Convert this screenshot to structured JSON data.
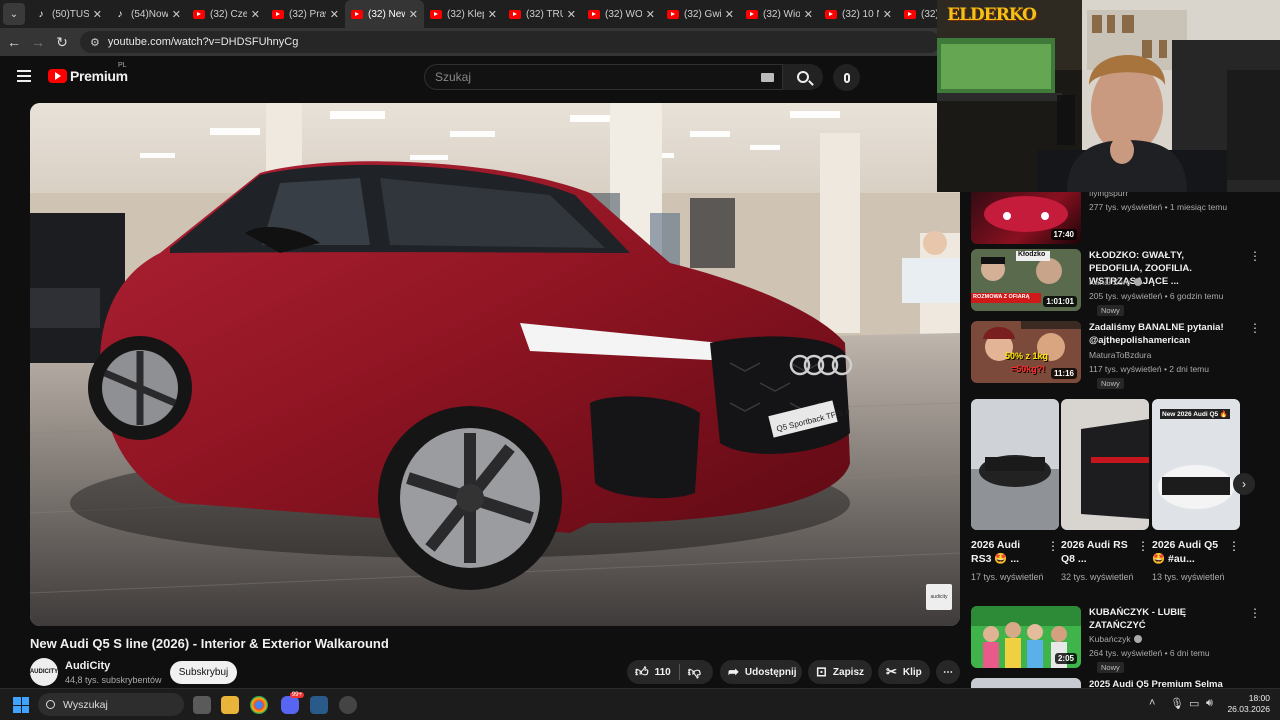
{
  "browser": {
    "tabs": [
      {
        "label": "(50)TUS2",
        "favicon": "tiktok-icon",
        "active": false
      },
      {
        "label": "(54)Now",
        "favicon": "tiktok-icon",
        "active": false
      },
      {
        "label": "(32) Czem",
        "favicon": "youtube-icon",
        "active": false
      },
      {
        "label": "(32) Prawd",
        "favicon": "youtube-icon",
        "active": false
      },
      {
        "label": "(32) New",
        "favicon": "youtube-icon",
        "active": true
      },
      {
        "label": "(32) Klep",
        "favicon": "youtube-icon",
        "active": false
      },
      {
        "label": "(32) TRU",
        "favicon": "youtube-icon",
        "active": false
      },
      {
        "label": "(32) WOJ",
        "favicon": "youtube-icon",
        "active": false
      },
      {
        "label": "(32) Gwia",
        "favicon": "youtube-icon",
        "active": false
      },
      {
        "label": "(32) Wio",
        "favicon": "youtube-icon",
        "active": false
      },
      {
        "label": "(32) 10 N",
        "favicon": "youtube-icon",
        "active": false
      },
      {
        "label": "(32) I",
        "favicon": "youtube-icon",
        "active": false
      }
    ],
    "url": "youtube.com/watch?v=DHDSFUhnyCg"
  },
  "youtube": {
    "logo_text": "Premium",
    "logo_region": "PL",
    "search_placeholder": "Szukaj"
  },
  "video": {
    "title": "New Audi Q5 S line (2026) - Interior & Exterior Walkaround",
    "channel": "AudiCity",
    "channel_avatar_text": "AUDICITY",
    "subscribers": "44,8 tys. subskrybentów",
    "subscribe_label": "Subskrybuj",
    "likes": "110",
    "share_label": "Udostępnij",
    "save_label": "Zapisz",
    "clip_label": "Klip",
    "plate_text": "Q5 Sportback TFSI e",
    "watermark_text": "audicity"
  },
  "stream_overlay": {
    "brand_text": "ELDERKO"
  },
  "sidebar": {
    "items": [
      {
        "title": "",
        "channel": "flyingspurr",
        "meta": "277 tys. wyświetleń • 1 miesiąc temu",
        "duration": "17:40",
        "badge": "",
        "verified": false
      },
      {
        "title": "KŁODZKO: GWAŁTY, PEDOFILIA, ZOOFILIA. WSTRZĄSAJĄCE ...",
        "channel": "Kanał Zero",
        "meta": "205 tys. wyświetleń • 6 godzin temu",
        "duration": "1:01:01",
        "badge": "Nowy",
        "verified": true,
        "thumb_caption": "Kłodzko",
        "thumb_banner": "ROZMOWA Z OFIARĄ"
      },
      {
        "title": "Zadaliśmy BANALNE pytania! @ajthepolishamerican",
        "channel": "MaturaToBzdura",
        "meta": "117 tys. wyświetleń • 2 dni temu",
        "duration": "11:16",
        "badge": "Nowy",
        "verified": false,
        "thumb_caption": "50% z 1kg",
        "thumb_caption2": "=50kg?!"
      },
      {
        "title": "KUBAŃCZYK - LUBIĘ ZATAŃCZYĆ",
        "channel": "Kubańczyk",
        "meta": "264 tys. wyświetleń • 6 dni temu",
        "duration": "2:05",
        "badge": "Nowy",
        "verified": true
      },
      {
        "title": "2025 Audi Q5 Premium Selma",
        "channel": "",
        "meta": "",
        "duration": "",
        "badge": "",
        "verified": false
      }
    ],
    "shorts": [
      {
        "title": "2026 Audi RS3 🤩 ...",
        "views": "17 tys. wyświetleń"
      },
      {
        "title": "2026 Audi RS Q8 ...",
        "views": "32 tys. wyświetleń"
      },
      {
        "title": "2026 Audi Q5 🤩 #au...",
        "views": "13 tys. wyświetleń",
        "thumb_caption": "New 2026 Audi Q5 🔥"
      }
    ]
  },
  "taskbar": {
    "search_label": "Wyszukaj",
    "time": "18:00",
    "date": "26.03.2026",
    "discord_badge": "99+"
  },
  "colors": {
    "youtube_red": "#ff0000",
    "car_red": "#8e1422",
    "background": "#0f0f0f",
    "windows_blue": "#3fa3ff"
  }
}
